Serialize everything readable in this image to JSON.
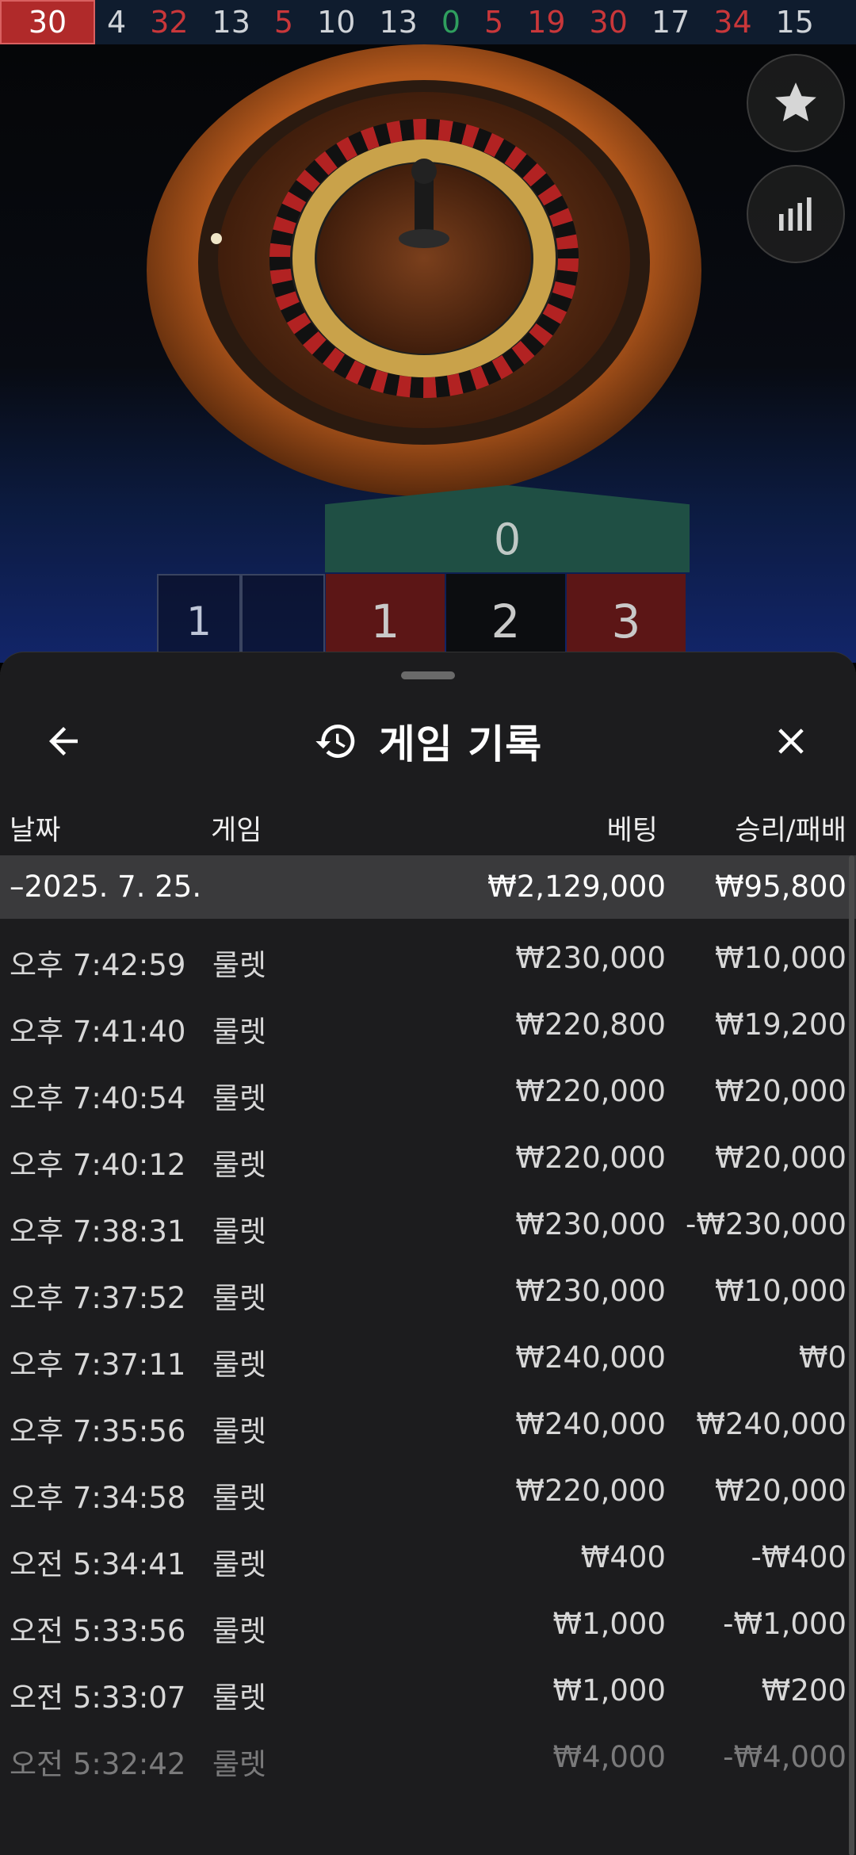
{
  "recent_results": [
    {
      "value": "30",
      "color": "red",
      "latest": true
    },
    {
      "value": "4",
      "color": "black"
    },
    {
      "value": "32",
      "color": "red"
    },
    {
      "value": "13",
      "color": "black"
    },
    {
      "value": "5",
      "color": "red"
    },
    {
      "value": "10",
      "color": "black"
    },
    {
      "value": "13",
      "color": "black"
    },
    {
      "value": "0",
      "color": "green"
    },
    {
      "value": "5",
      "color": "red"
    },
    {
      "value": "19",
      "color": "red"
    },
    {
      "value": "30",
      "color": "red"
    },
    {
      "value": "17",
      "color": "black"
    },
    {
      "value": "34",
      "color": "red"
    },
    {
      "value": "15",
      "color": "black"
    }
  ],
  "side_buttons": {
    "favorites_icon": "star-icon",
    "statistics_icon": "bar-chart-icon"
  },
  "betting_table": {
    "zero": "0",
    "numbers": [
      "1",
      "2",
      "3"
    ],
    "side_label": "1"
  },
  "panel": {
    "title": "게임 기록",
    "title_icon": "history-icon",
    "back_icon": "arrow-left-icon",
    "close_icon": "close-icon"
  },
  "columns": {
    "date": "날짜",
    "game": "게임",
    "bet": "베팅",
    "win_loss": "승리/패배"
  },
  "summary": {
    "date": "–2025. 7. 25.",
    "bet": "₩2,129,000",
    "win_loss": "₩95,800"
  },
  "rows": [
    {
      "time": "오후 7:42:59",
      "game": "룰렛",
      "bet": "₩230,000",
      "win_loss": "₩10,000"
    },
    {
      "time": "오후 7:41:40",
      "game": "룰렛",
      "bet": "₩220,800",
      "win_loss": "₩19,200"
    },
    {
      "time": "오후 7:40:54",
      "game": "룰렛",
      "bet": "₩220,000",
      "win_loss": "₩20,000"
    },
    {
      "time": "오후 7:40:12",
      "game": "룰렛",
      "bet": "₩220,000",
      "win_loss": "₩20,000"
    },
    {
      "time": "오후 7:38:31",
      "game": "룰렛",
      "bet": "₩230,000",
      "win_loss": "-₩230,000"
    },
    {
      "time": "오후 7:37:52",
      "game": "룰렛",
      "bet": "₩230,000",
      "win_loss": "₩10,000"
    },
    {
      "time": "오후 7:37:11",
      "game": "룰렛",
      "bet": "₩240,000",
      "win_loss": "₩0"
    },
    {
      "time": "오후 7:35:56",
      "game": "룰렛",
      "bet": "₩240,000",
      "win_loss": "₩240,000"
    },
    {
      "time": "오후 7:34:58",
      "game": "룰렛",
      "bet": "₩220,000",
      "win_loss": "₩20,000"
    },
    {
      "time": "오전 5:34:41",
      "game": "룰렛",
      "bet": "₩400",
      "win_loss": "-₩400"
    },
    {
      "time": "오전 5:33:56",
      "game": "룰렛",
      "bet": "₩1,000",
      "win_loss": "-₩1,000"
    },
    {
      "time": "오전 5:33:07",
      "game": "룰렛",
      "bet": "₩1,000",
      "win_loss": "₩200"
    },
    {
      "time": "오전 5:32:42",
      "game": "룰렛",
      "bet": "₩4,000",
      "win_loss": "-₩4,000"
    }
  ]
}
